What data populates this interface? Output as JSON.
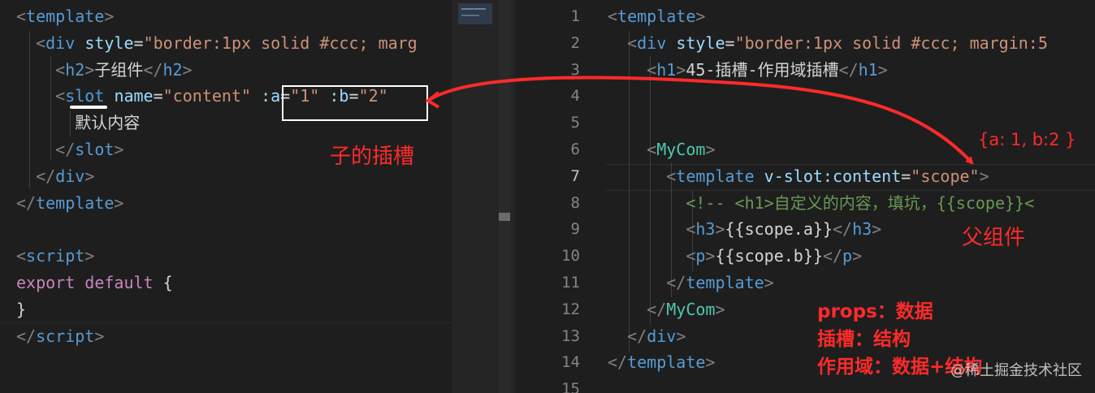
{
  "left_code": {
    "lines": [
      [
        [
          "p",
          "<"
        ],
        [
          "t",
          "template"
        ],
        [
          "p",
          ">"
        ]
      ],
      [
        [
          "tx",
          "  "
        ],
        [
          "p",
          "<"
        ],
        [
          "t",
          "div"
        ],
        [
          "tx",
          " "
        ],
        [
          "a",
          "style"
        ],
        [
          "tx",
          "="
        ],
        [
          "s",
          "\"border:1px solid #ccc; marg"
        ]
      ],
      [
        [
          "tx",
          "    "
        ],
        [
          "p",
          "<"
        ],
        [
          "t",
          "h2"
        ],
        [
          "p",
          ">"
        ],
        [
          "tx",
          "子组件"
        ],
        [
          "p",
          "</"
        ],
        [
          "t",
          "h2"
        ],
        [
          "p",
          ">"
        ]
      ],
      [
        [
          "tx",
          "    "
        ],
        [
          "p",
          "<"
        ],
        [
          "t",
          "slot"
        ],
        [
          "tx",
          " "
        ],
        [
          "a",
          "name"
        ],
        [
          "tx",
          "="
        ],
        [
          "s",
          "\"content\""
        ],
        [
          "tx",
          " "
        ],
        [
          "a",
          ":a"
        ],
        [
          "tx",
          "="
        ],
        [
          "s",
          "\"1\""
        ],
        [
          "tx",
          " "
        ],
        [
          "a",
          ":b"
        ],
        [
          "tx",
          "="
        ],
        [
          "s",
          "\"2\""
        ]
      ],
      [
        [
          "tx",
          "      默认内容"
        ]
      ],
      [
        [
          "tx",
          "    "
        ],
        [
          "p",
          "</"
        ],
        [
          "t",
          "slot"
        ],
        [
          "p",
          ">"
        ]
      ],
      [
        [
          "tx",
          "  "
        ],
        [
          "p",
          "</"
        ],
        [
          "t",
          "div"
        ],
        [
          "p",
          ">"
        ]
      ],
      [
        [
          "p",
          "</"
        ],
        [
          "t",
          "template"
        ],
        [
          "p",
          ">"
        ]
      ],
      [],
      [
        [
          "p",
          "<"
        ],
        [
          "t",
          "script"
        ],
        [
          "p",
          ">"
        ]
      ],
      [
        [
          "k",
          "export"
        ],
        [
          "tx",
          " "
        ],
        [
          "k",
          "default"
        ],
        [
          "tx",
          " {"
        ]
      ],
      [
        [
          "tx",
          "}"
        ]
      ],
      [
        [
          "p",
          "</"
        ],
        [
          "t",
          "script"
        ],
        [
          "p",
          ">"
        ]
      ]
    ]
  },
  "right_code": {
    "line_numbers": [
      "1",
      "2",
      "3",
      "4",
      "5",
      "6",
      "7",
      "8",
      "9",
      "10",
      "11",
      "12",
      "13",
      "14",
      "15"
    ],
    "lines": [
      [
        [
          "p",
          "<"
        ],
        [
          "t",
          "template"
        ],
        [
          "p",
          ">"
        ]
      ],
      [
        [
          "tx",
          "  "
        ],
        [
          "p",
          "<"
        ],
        [
          "t",
          "div"
        ],
        [
          "tx",
          " "
        ],
        [
          "a",
          "style"
        ],
        [
          "tx",
          "="
        ],
        [
          "s",
          "\"border:1px solid #ccc; margin:5"
        ]
      ],
      [
        [
          "tx",
          "    "
        ],
        [
          "p",
          "<"
        ],
        [
          "t",
          "h1"
        ],
        [
          "p",
          ">"
        ],
        [
          "tx",
          "45-插槽-作用域插槽"
        ],
        [
          "p",
          "</"
        ],
        [
          "t",
          "h1"
        ],
        [
          "p",
          ">"
        ]
      ],
      [],
      [],
      [
        [
          "tx",
          "    "
        ],
        [
          "p",
          "<"
        ],
        [
          "c",
          "MyCom"
        ],
        [
          "p",
          ">"
        ]
      ],
      [
        [
          "tx",
          "      "
        ],
        [
          "p",
          "<"
        ],
        [
          "t",
          "template"
        ],
        [
          "tx",
          " "
        ],
        [
          "a",
          "v-slot:content"
        ],
        [
          "tx",
          "="
        ],
        [
          "s",
          "\"scope\""
        ],
        [
          "p",
          ">"
        ]
      ],
      [
        [
          "tx",
          "        "
        ],
        [
          "cm",
          "<!-- <h1>自定义的内容，填坑，{{scope}}<"
        ]
      ],
      [
        [
          "tx",
          "        "
        ],
        [
          "p",
          "<"
        ],
        [
          "t",
          "h3"
        ],
        [
          "p",
          ">"
        ],
        [
          "tx",
          "{{scope.a}}"
        ],
        [
          "p",
          "</"
        ],
        [
          "t",
          "h3"
        ],
        [
          "p",
          ">"
        ]
      ],
      [
        [
          "tx",
          "        "
        ],
        [
          "p",
          "<"
        ],
        [
          "t",
          "p"
        ],
        [
          "p",
          ">"
        ],
        [
          "tx",
          "{{scope.b}}"
        ],
        [
          "p",
          "</"
        ],
        [
          "t",
          "p"
        ],
        [
          "p",
          ">"
        ]
      ],
      [
        [
          "tx",
          "      "
        ],
        [
          "p",
          "</"
        ],
        [
          "t",
          "template"
        ],
        [
          "p",
          ">"
        ]
      ],
      [
        [
          "tx",
          "    "
        ],
        [
          "p",
          "</"
        ],
        [
          "c",
          "MyCom"
        ],
        [
          "p",
          ">"
        ]
      ],
      [
        [
          "tx",
          "  "
        ],
        [
          "p",
          "</"
        ],
        [
          "t",
          "div"
        ],
        [
          "p",
          ">"
        ]
      ],
      [
        [
          "p",
          "</"
        ],
        [
          "t",
          "template"
        ],
        [
          "p",
          ">"
        ]
      ],
      []
    ]
  },
  "annotations": {
    "child_slot": "子的插槽",
    "scope_value": "{a: 1, b:2 }",
    "parent_component": "父组件",
    "props_line": "props：数据",
    "slot_line": "插槽：结构",
    "scope_line": "作用域：数据+结构"
  },
  "watermark": "@稀土掘金技术社区",
  "colors": {
    "background": "#1e1e1e",
    "tag": "#569cd6",
    "attribute": "#9cdcfe",
    "string": "#ce9178",
    "component": "#4ec9b0",
    "keyword": "#c586c0",
    "comment": "#6a9955",
    "annotation_red": "#ff2a2a"
  }
}
